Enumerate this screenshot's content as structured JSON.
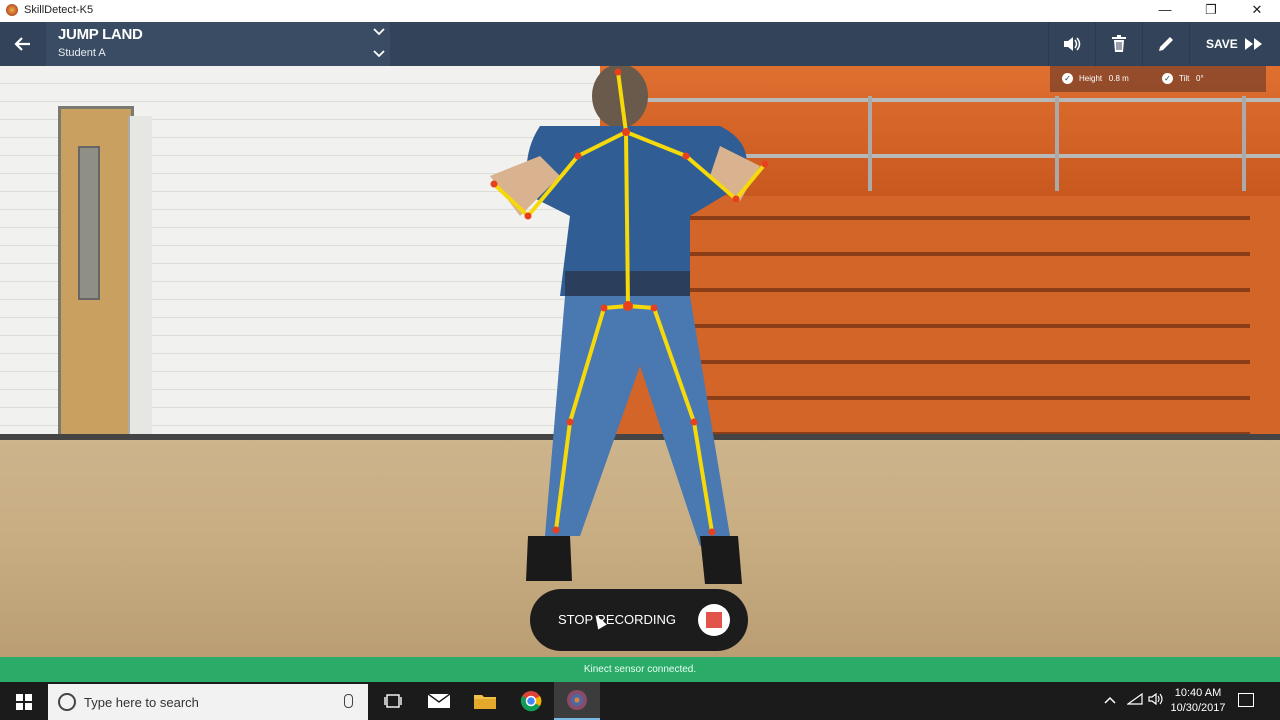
{
  "window": {
    "title": "SkillDetect-K5",
    "buttons": [
      "—",
      "❐",
      "✕"
    ]
  },
  "header": {
    "back_icon": "arrow-left-icon",
    "title": "JUMP LAND",
    "subtitle": "Student A",
    "tools": [
      "volume-icon",
      "trash-icon",
      "pencil-icon"
    ],
    "save_label": "SAVE",
    "save_icon": "fast-forward-icon"
  },
  "overlay": {
    "height_label": "Height",
    "height_value": "0.8 m",
    "tilt_label": "Tilt",
    "tilt_value": "0°"
  },
  "recording": {
    "button_label": "STOP RECORDING"
  },
  "status": {
    "message": "Kinect sensor connected."
  },
  "taskbar": {
    "search_placeholder": "Type here to search",
    "time": "10:40 AM",
    "date": "10/30/2017"
  },
  "colors": {
    "header": "#33445a",
    "status_bar": "#2aab68",
    "skeleton": "#f5d90a",
    "joint": "#e8401c"
  }
}
